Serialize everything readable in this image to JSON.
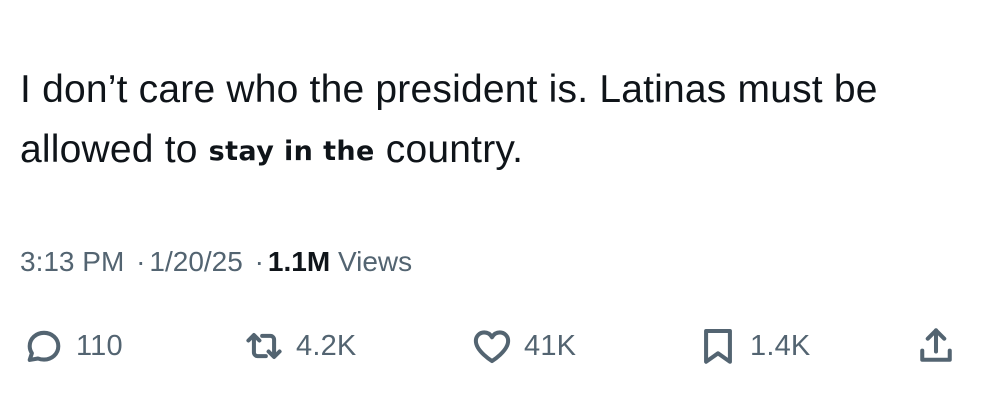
{
  "tweet": {
    "text_line1": "I don’t care who the president is. Latinas must be",
    "text_line2_pre": "allowed to ",
    "text_line2_bold": "stay in the",
    "text_line2_post": " country."
  },
  "meta": {
    "time": "3:13 PM",
    "separator": "·",
    "date": "1/20/25",
    "views_count": "1.1M",
    "views_label": "Views"
  },
  "actions": {
    "replies": {
      "icon": "reply-icon",
      "count": "110"
    },
    "retweets": {
      "icon": "retweet-icon",
      "count": "4.2K"
    },
    "likes": {
      "icon": "heart-icon",
      "count": "41K"
    },
    "bookmarks": {
      "icon": "bookmark-icon",
      "count": "1.4K"
    },
    "share": {
      "icon": "share-icon"
    }
  },
  "colors": {
    "text": "#0f1419",
    "secondary": "#536471",
    "background": "#ffffff"
  }
}
